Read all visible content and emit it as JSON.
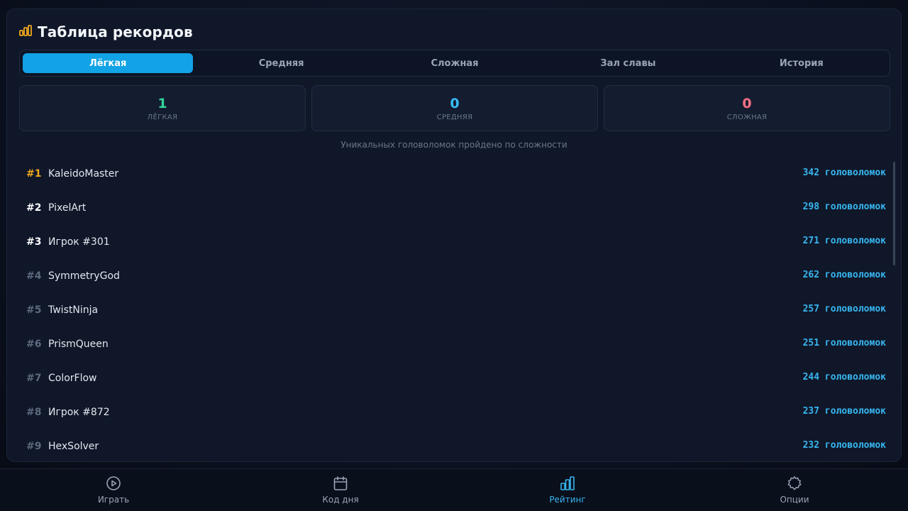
{
  "header": {
    "title": "Таблица рекордов",
    "icon": "bar-chart-icon",
    "icon_color": "#f2a81d"
  },
  "tabs": [
    {
      "label": "Лёгкая",
      "active": true
    },
    {
      "label": "Средняя",
      "active": false
    },
    {
      "label": "Сложная",
      "active": false
    },
    {
      "label": "Зал славы",
      "active": false
    },
    {
      "label": "История",
      "active": false
    }
  ],
  "stats": [
    {
      "value": "1",
      "label": "ЛЁГКАЯ",
      "color": "#34d399"
    },
    {
      "value": "0",
      "label": "СРЕДНЯЯ",
      "color": "#38bdf8"
    },
    {
      "value": "0",
      "label": "СЛОЖНАЯ",
      "color": "#fb7185"
    }
  ],
  "caption": "Уникальных головоломок пройдено по сложности",
  "leaderboard": [
    {
      "rank": "#1",
      "name": "KaleidoMaster",
      "score": "342 головоломок"
    },
    {
      "rank": "#2",
      "name": "PixelArt",
      "score": "298 головоломок"
    },
    {
      "rank": "#3",
      "name": "Игрок #301",
      "score": "271 головоломок"
    },
    {
      "rank": "#4",
      "name": "SymmetryGod",
      "score": "262 головоломок"
    },
    {
      "rank": "#5",
      "name": "TwistNinja",
      "score": "257 головоломок"
    },
    {
      "rank": "#6",
      "name": "PrismQueen",
      "score": "251 головоломок"
    },
    {
      "rank": "#7",
      "name": "ColorFlow",
      "score": "244 головоломок"
    },
    {
      "rank": "#8",
      "name": "Игрок #872",
      "score": "237 головоломок"
    },
    {
      "rank": "#9",
      "name": "HexSolver",
      "score": "232 головоломок"
    }
  ],
  "rank_colors": {
    "first": "#f2a81d",
    "top3": "#ffffff",
    "rest": "#5d6a7e"
  },
  "nav": [
    {
      "label": "Играть",
      "icon": "play-circle-icon",
      "active": false
    },
    {
      "label": "Код дня",
      "icon": "calendar-icon",
      "active": false
    },
    {
      "label": "Рейтинг",
      "icon": "bar-chart-icon",
      "active": true
    },
    {
      "label": "Опции",
      "icon": "gear-icon",
      "active": false
    }
  ],
  "colors": {
    "accent": "#12a3e6",
    "score": "#38b6f0"
  }
}
